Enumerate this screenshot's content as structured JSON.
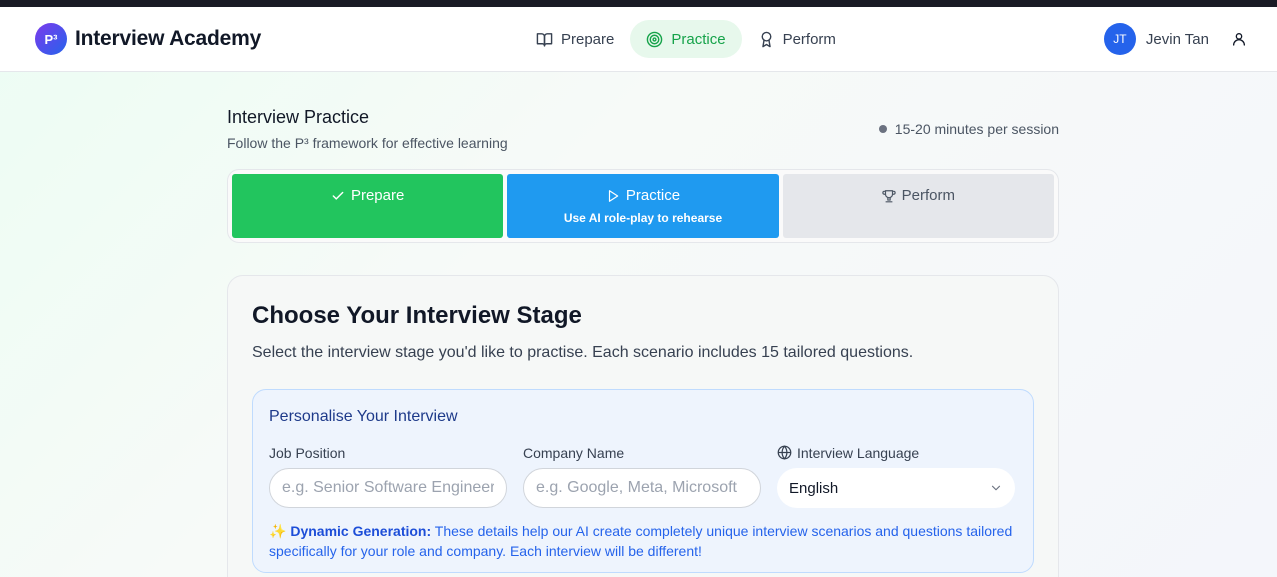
{
  "header": {
    "logo_text": "P³",
    "brand": "Interview Academy",
    "nav": [
      {
        "label": "Prepare",
        "icon": "book-icon"
      },
      {
        "label": "Practice",
        "icon": "target-icon"
      },
      {
        "label": "Perform",
        "icon": "award-icon"
      }
    ],
    "user": {
      "initials": "JT",
      "name": "Jevin Tan"
    }
  },
  "page": {
    "title": "Interview Practice",
    "subtitle": "Follow the P³ framework for effective learning",
    "session": "15-20 minutes per session"
  },
  "steps": [
    {
      "label": "Prepare",
      "state": "done",
      "icon": "check-icon"
    },
    {
      "label": "Practice",
      "state": "current",
      "icon": "play-icon",
      "desc": "Use AI role-play to rehearse"
    },
    {
      "label": "Perform",
      "state": "locked",
      "icon": "trophy-icon"
    }
  ],
  "stage": {
    "title": "Choose Your Interview Stage",
    "subtitle": "Select the interview stage you'd like to practise. Each scenario includes 15 tailored questions."
  },
  "personalise": {
    "title": "Personalise Your Interview",
    "job_label": "Job Position",
    "job_placeholder": "e.g. Senior Software Engineer",
    "company_label": "Company Name",
    "company_placeholder": "e.g. Google, Meta, Microsoft",
    "language_label": "Interview Language",
    "language_value": "English",
    "note_icon": "✨",
    "note_bold": "Dynamic Generation:",
    "note_text": "These details help our AI create completely unique interview scenarios and questions tailored specifically for your role and company. Each interview will be different!"
  },
  "colors": {
    "accent_green": "#22c55e",
    "accent_blue": "#1f9af0",
    "brand_blue": "#2563eb"
  }
}
